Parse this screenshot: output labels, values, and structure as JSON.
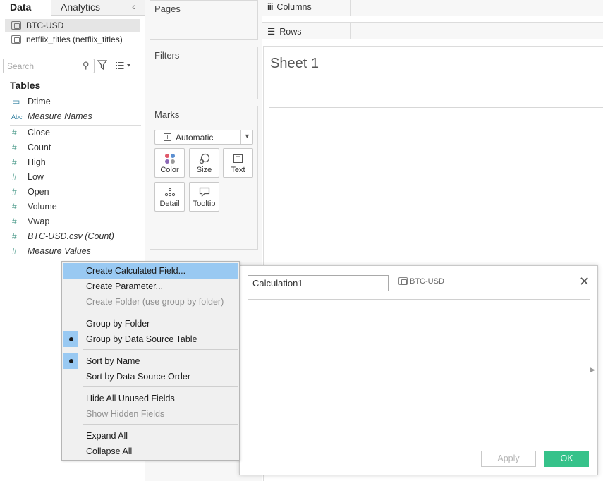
{
  "left_pane": {
    "tabs": {
      "data": "Data",
      "analytics": "Analytics"
    },
    "data_sources": [
      "BTC-USD",
      "netflix_titles (netflix_titles)"
    ],
    "search": {
      "placeholder": "Search",
      "value": ""
    },
    "tables_heading": "Tables",
    "fields": [
      {
        "name": "Dtime",
        "icon": "calendar-icon",
        "italic": false
      },
      {
        "name": "Measure Names",
        "icon": "abc-icon",
        "italic": true
      },
      {
        "name": "Close",
        "icon": "number-icon",
        "italic": false
      },
      {
        "name": "Count",
        "icon": "number-icon",
        "italic": false
      },
      {
        "name": "High",
        "icon": "number-icon",
        "italic": false
      },
      {
        "name": "Low",
        "icon": "number-icon",
        "italic": false
      },
      {
        "name": "Open",
        "icon": "number-icon",
        "italic": false
      },
      {
        "name": "Volume",
        "icon": "number-icon",
        "italic": false
      },
      {
        "name": "Vwap",
        "icon": "number-icon",
        "italic": false
      },
      {
        "name": "BTC-USD.csv (Count)",
        "icon": "number-icon",
        "italic": true
      },
      {
        "name": "Measure Values",
        "icon": "number-icon",
        "italic": true
      }
    ],
    "field_icon_glyphs": {
      "calendar": "▭",
      "abc": "Abc",
      "number": "#"
    }
  },
  "shelves": {
    "pages": "Pages",
    "filters": "Filters",
    "marks": {
      "title": "Marks",
      "type": "Automatic",
      "buttons": [
        "Color",
        "Size",
        "Text",
        "Detail",
        "Tooltip"
      ]
    },
    "columns": "Columns",
    "rows": "Rows"
  },
  "sheet": {
    "title": "Sheet 1"
  },
  "calc_dialog": {
    "name_value": "Calculation1",
    "data_source": "BTC-USD",
    "apply_label": "Apply",
    "ok_label": "OK",
    "close_glyph": "✕"
  },
  "context_menu": {
    "items": [
      {
        "label": "Create Calculated Field...",
        "state": "highlighted",
        "checked": false
      },
      {
        "label": "Create Parameter...",
        "state": "enabled",
        "checked": false
      },
      {
        "label": "Create Folder (use group by folder)",
        "state": "disabled",
        "checked": false
      },
      {
        "label": "Group by Folder",
        "state": "enabled",
        "checked": false
      },
      {
        "label": "Group by Data Source Table",
        "state": "enabled",
        "checked": true
      },
      {
        "label": "Sort by Name",
        "state": "enabled",
        "checked": true
      },
      {
        "label": "Sort by Data Source Order",
        "state": "enabled",
        "checked": false
      },
      {
        "label": "Hide All Unused Fields",
        "state": "enabled",
        "checked": false
      },
      {
        "label": "Show Hidden Fields",
        "state": "disabled",
        "checked": false
      },
      {
        "label": "Expand All",
        "state": "enabled",
        "checked": false
      },
      {
        "label": "Collapse All",
        "state": "enabled",
        "checked": false
      }
    ]
  },
  "colors": {
    "menu_highlight": "#99c9f2",
    "ok_button": "#36c28a",
    "field_icon": "#4a9a8a",
    "dimension_icon": "#2f7fa0"
  }
}
